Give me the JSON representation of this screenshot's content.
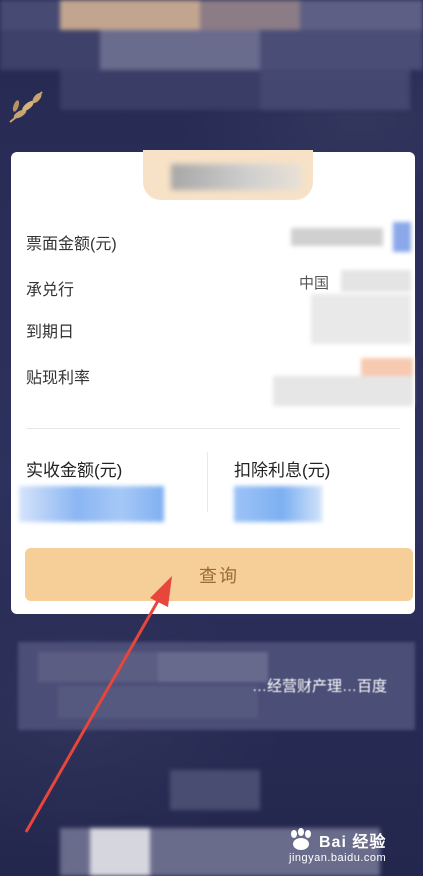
{
  "form": {
    "face_amount_label": "票面金额(元)",
    "acceptor_label": "承兑行",
    "acceptor_value_visible": "中国",
    "due_date_label": "到期日",
    "discount_rate_label": "贴现利率"
  },
  "result": {
    "received_label": "实收金额(元)",
    "interest_label": "扣除利息(元)"
  },
  "query_button": "查询",
  "lower_text": "…经营财产理…百度",
  "watermark": {
    "line1": "Bai 经验",
    "line2": "jingyan.baidu.com"
  },
  "colors": {
    "background": "#2a2e5a",
    "card": "#ffffff",
    "button": "#f6cf98",
    "button_text": "#9a6b37",
    "arrow": "#e8453c"
  }
}
